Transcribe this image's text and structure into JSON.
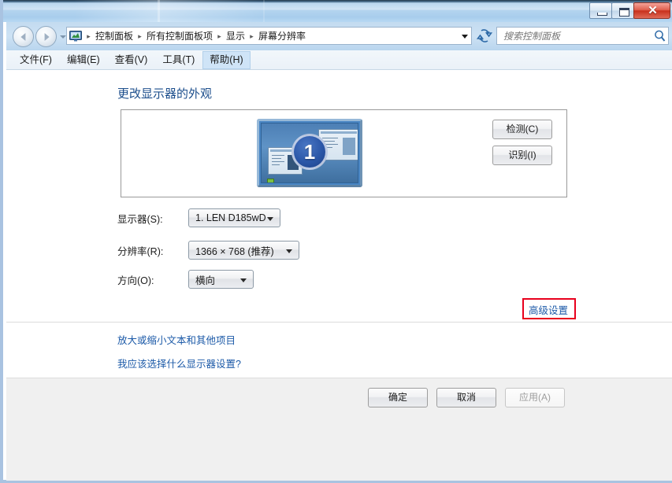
{
  "window": {
    "controls": {
      "minimize_label": "—",
      "maximize_label": "□",
      "close_label": "✕"
    }
  },
  "navigation": {
    "back_title": "后退",
    "forward_title": "前进",
    "breadcrumb": [
      "控制面板",
      "所有控制面板项",
      "显示",
      "屏幕分辨率"
    ],
    "separator": "▸",
    "refresh_label": "↻"
  },
  "search": {
    "placeholder": "搜索控制面板",
    "value": ""
  },
  "menubar": {
    "items": [
      {
        "label": "文件(F)",
        "active": false
      },
      {
        "label": "编辑(E)",
        "active": false
      },
      {
        "label": "查看(V)",
        "active": false
      },
      {
        "label": "工具(T)",
        "active": false
      },
      {
        "label": "帮助(H)",
        "active": true
      }
    ]
  },
  "main": {
    "page_title": "更改显示器的外观",
    "monitor_badge": "1",
    "side_buttons": {
      "detect": "检测(C)",
      "identify": "识别(I)"
    },
    "fields": {
      "display": {
        "label": "显示器(S):",
        "value": "1. LEN D185wD"
      },
      "resolution": {
        "label": "分辨率(R):",
        "value": "1366 × 768 (推荐)"
      },
      "orientation": {
        "label": "方向(O):",
        "value": "横向"
      }
    },
    "advanced_link": "高级设置",
    "links": [
      "放大或缩小文本和其他项目",
      "我应该选择什么显示器设置?"
    ]
  },
  "footer": {
    "ok": "确定",
    "cancel": "取消",
    "apply": "应用(A)"
  },
  "colors": {
    "accent_link": "#1c5aa8",
    "title_heading": "#1c4e8c",
    "annotation_red": "#e8001d",
    "titlebar_blue": "#b8d8f2",
    "close_red": "#c8301c"
  }
}
